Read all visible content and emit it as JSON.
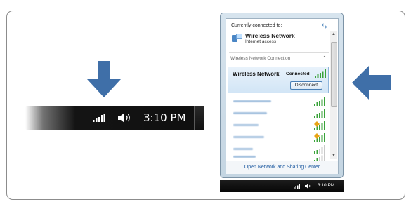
{
  "taskbar": {
    "clock": "3:10 PM",
    "signal_icon": "wifi-signal-icon",
    "volume_icon": "speaker-icon"
  },
  "popup": {
    "header": "Currently connected to:",
    "refresh_icon": "refresh-icon",
    "current_network": {
      "name": "Wireless Network",
      "status": "Internet access"
    },
    "section_title": "Wireless Network Connection",
    "selected_network": {
      "name": "Wireless Network",
      "status": "Connected",
      "button_label": "Disconnect"
    },
    "other_networks": [
      {
        "signal": 4,
        "secure_warning": false
      },
      {
        "signal": 4,
        "secure_warning": false
      },
      {
        "signal": 4,
        "secure_warning": true
      },
      {
        "signal": 4,
        "secure_warning": true
      },
      {
        "signal": 2,
        "secure_warning": false
      },
      {
        "signal": 2,
        "secure_warning": false
      }
    ],
    "footer_link": "Open Network and Sharing Center"
  },
  "colors": {
    "arrow": "#3f6fa8",
    "signal_green": "#3aa33a",
    "link": "#1e5aa0"
  }
}
